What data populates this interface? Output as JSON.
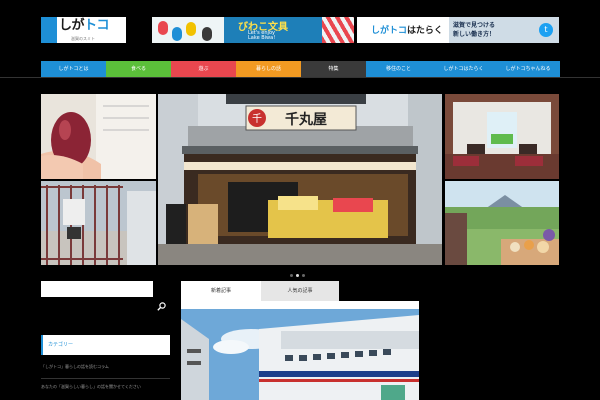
{
  "header": {
    "logo": {
      "title_a": "しが",
      "title_b": "トコ",
      "tagline": "滋賀のスミト"
    },
    "banner_biwako": {
      "title": "びわこ文具",
      "subtitle_1": "Let's enjoy",
      "subtitle_2": "Lake Biwa!"
    },
    "banner_work": {
      "title_a": "しが",
      "title_b": "トコ",
      "title_c": "はたらく",
      "line1": "滋賀で見つける",
      "line2": "新しい働き方！"
    }
  },
  "nav": {
    "items": [
      {
        "label": "しがトコとは",
        "color": "#1e8fd6",
        "w": 65
      },
      {
        "label": "食べる",
        "color": "#5bbf3a",
        "w": 65
      },
      {
        "label": "遊ぶ",
        "color": "#e9474f",
        "w": 65
      },
      {
        "label": "暮らしの話",
        "color": "#f29a22",
        "w": 65
      },
      {
        "label": "特集",
        "color": "#3a3a3a",
        "w": 65
      },
      {
        "label": "移住のこと",
        "color": "#1e8fd6",
        "w": 65
      },
      {
        "label": "しがトコはたらく",
        "color": "#1e8fd6",
        "w": 65
      },
      {
        "label": "しがトコちゃんねる",
        "color": "#1e8fd6",
        "w": 64
      }
    ]
  },
  "slider": {
    "shop_sign_1": "千",
    "shop_sign_2": "千丸屋",
    "current_slide": 2,
    "slide_count": 3
  },
  "sidebar": {
    "search": {
      "placeholder": ""
    },
    "widget_title": "カテゴリー",
    "line1": "「しがトコ」暮らしの話を読むコラム",
    "line2": "あなたの「滋賀らしい暮らし」の話を聞かせてください"
  },
  "tabs": {
    "tab1": "新着記事",
    "tab2": "人気の記事"
  },
  "colors": {
    "accent": "#1e8fd6"
  }
}
